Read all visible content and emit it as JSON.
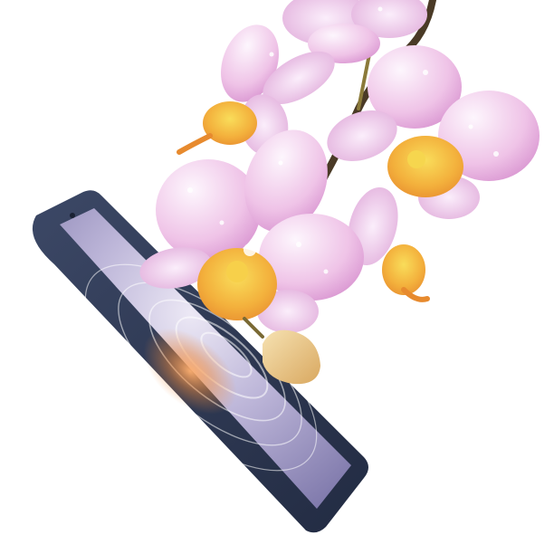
{
  "scene": {
    "background_color": "#ffffff",
    "subject": "orchid-on-smartphone",
    "phone": {
      "body_color": "#2e3a57",
      "screen_color_light": "#e6e2f2",
      "screen_color_mid": "#b9b3d6",
      "screen_color_dark": "#7f78ad",
      "glow_color": "#f08a3a"
    },
    "orchid": {
      "petal_light": "#fbf1fb",
      "petal_pink": "#e7a9dc",
      "petal_deep": "#c877c0",
      "lip_orange": "#f0a23a",
      "lip_yellow": "#f7d04a",
      "bud_color": "#e9c98a",
      "stem_color": "#4a3a26",
      "blossom_count": 5
    }
  }
}
